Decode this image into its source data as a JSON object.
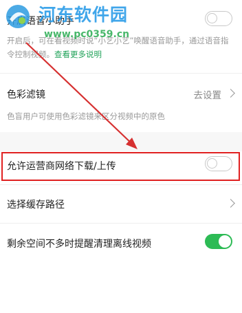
{
  "voice_assistant": {
    "title": "开启语音小助手",
    "desc_line1": "开启后，可在看视频时说“小艺小艺”唤醒语音助手，通过语音指",
    "desc_line2_prefix": "令控制视频。",
    "desc_link": "查看更多说明",
    "toggle_state": "off"
  },
  "color_filter": {
    "title": "色彩滤镜",
    "value": "去设置",
    "desc": "色盲用户可使用色彩滤镜来区分视频中的原色"
  },
  "mobile_download": {
    "title": "允许运营商网络下载/上传",
    "toggle_state": "off"
  },
  "cache_path": {
    "title": "选择缓存路径"
  },
  "low_space": {
    "title": "剩余空间不多时提醒清理离线视频",
    "toggle_state": "on"
  },
  "watermark": {
    "title": "河东软件园",
    "url": "www.pc0359.cn"
  },
  "colors": {
    "accent_green": "#2dbb55",
    "highlight_red": "#e02020",
    "arrow_red": "#d63030"
  }
}
